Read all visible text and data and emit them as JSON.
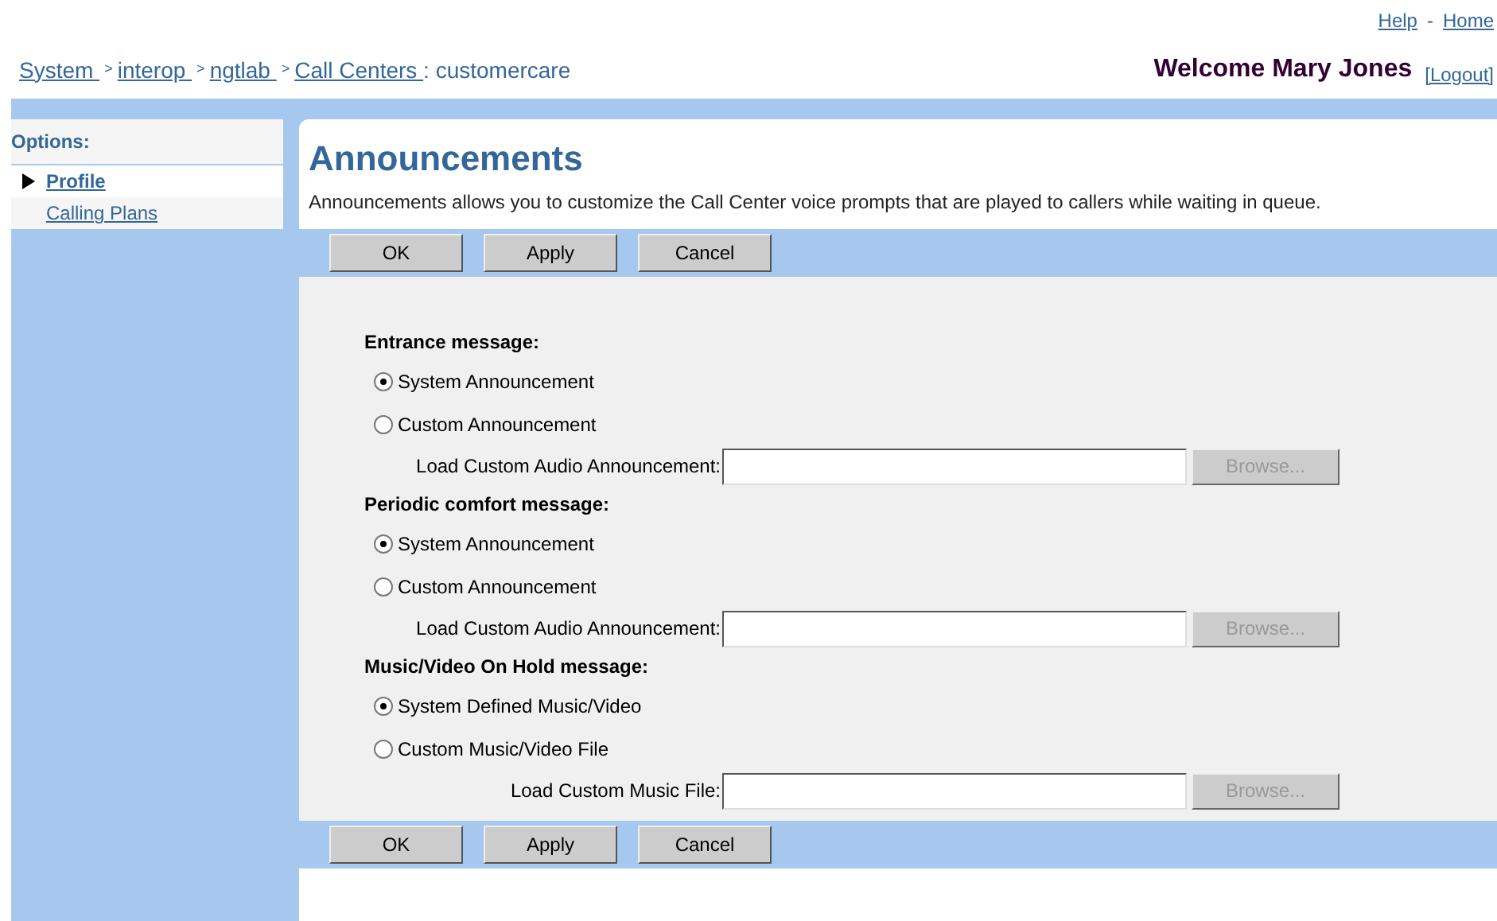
{
  "top_links": [
    "Help",
    "-",
    "Home"
  ],
  "breadcrumb": [
    {
      "kind": "link",
      "label": "System "
    },
    {
      "kind": "separator",
      "label": ">"
    },
    {
      "kind": "link",
      "label": "interop "
    },
    {
      "kind": "separator",
      "label": ">"
    },
    {
      "kind": "link",
      "label": "ngtlab "
    },
    {
      "kind": "separator",
      "label": ">"
    },
    {
      "kind": "link",
      "label": "Call Centers "
    },
    {
      "kind": "text",
      "label": ": customercare"
    }
  ],
  "welcome": "Welcome Mary Jones",
  "logout": "[Logout]",
  "sidebar": {
    "title": "Options:",
    "items": [
      {
        "label": "Profile",
        "selected": true
      },
      {
        "label": "Calling Plans",
        "selected": false
      }
    ]
  },
  "page": {
    "title": "Announcements",
    "description": "Announcements allows you to customize the Call Center voice prompts that are played to callers while waiting in queue."
  },
  "buttons": [
    "OK",
    "Apply",
    "Cancel"
  ],
  "sections": [
    {
      "title": "Entrance message:",
      "options": [
        {
          "label": "System Announcement",
          "selected": true
        },
        {
          "label": "Custom Announcement",
          "selected": false
        }
      ],
      "file_label": "Load Custom Audio Announcement:",
      "browse": "Browse...",
      "browse_disabled": true
    },
    {
      "title": "Periodic comfort message:",
      "options": [
        {
          "label": "System Announcement",
          "selected": true
        },
        {
          "label": "Custom Announcement",
          "selected": false
        }
      ],
      "file_label": "Load Custom Audio Announcement:",
      "browse": "Browse...",
      "browse_disabled": true
    },
    {
      "title": "Music/Video On Hold message:",
      "options": [
        {
          "label": "System Defined Music/Video",
          "selected": true
        },
        {
          "label": "Custom Music/Video File",
          "selected": false
        }
      ],
      "file_label": "Load Custom Music File:",
      "browse": "Browse...",
      "browse_disabled": true
    }
  ],
  "bottom_buttons": [
    "OK",
    "Apply",
    "Cancel"
  ]
}
